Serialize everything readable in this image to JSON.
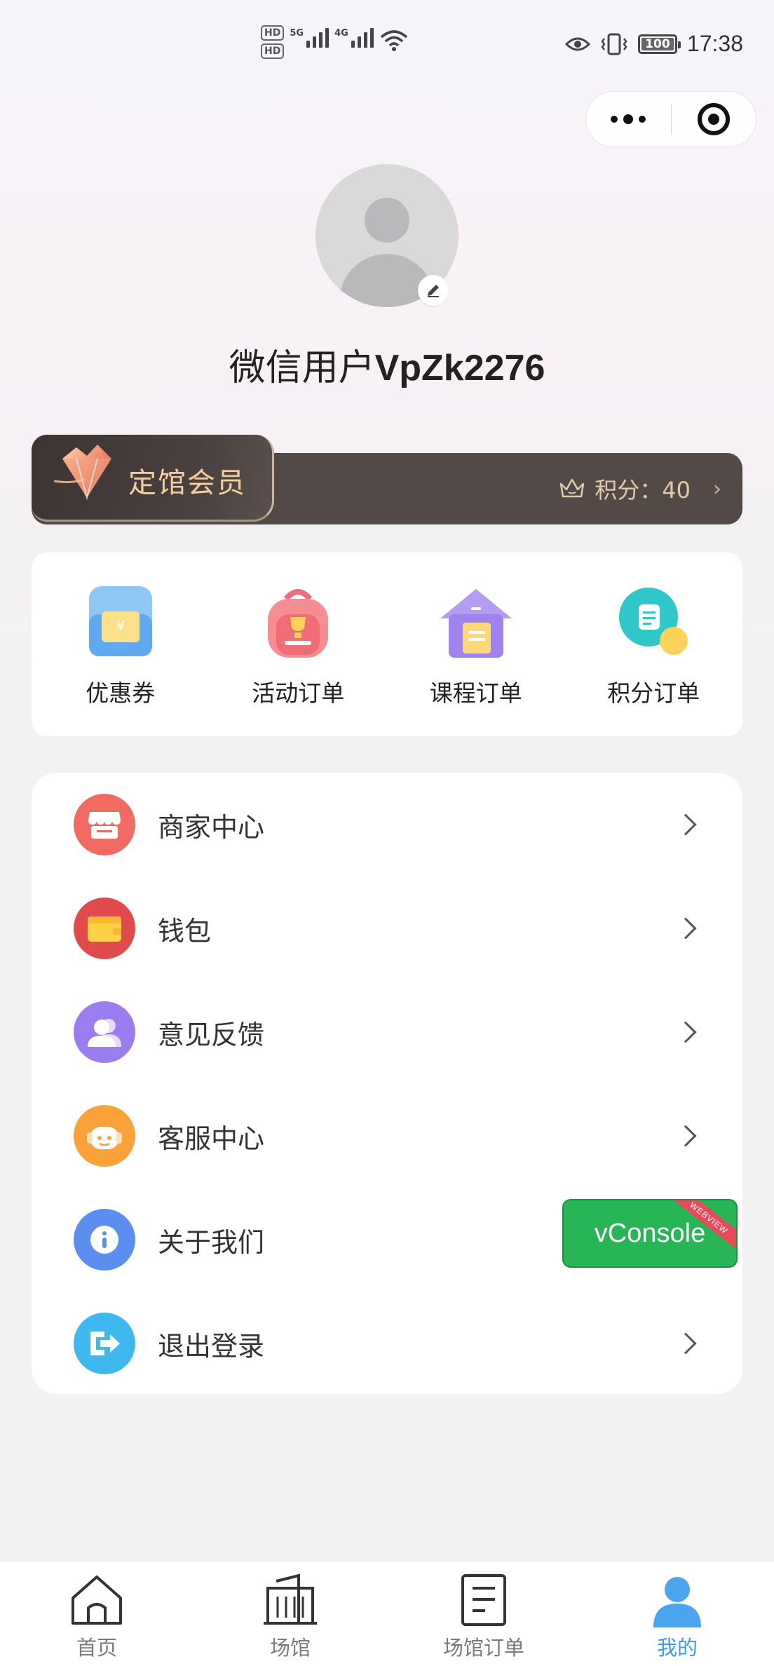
{
  "status_bar": {
    "hd1": "HD",
    "hd2": "HD",
    "net1": "5G",
    "net2": "4G",
    "battery": "100",
    "time": "17:38"
  },
  "capsule": {
    "more_icon": "more-dots-icon",
    "close_icon": "target-icon"
  },
  "profile": {
    "name_prefix": "微信用户",
    "name_suffix": "VpZk2276"
  },
  "member": {
    "title": "定馆会员",
    "points_label": "积分：40",
    "colors": {
      "bar": "#534a48",
      "gold": "#f4cf9d"
    }
  },
  "shortcuts": [
    {
      "label": "优惠券",
      "icon": "coupon-icon"
    },
    {
      "label": "活动订单",
      "icon": "trophy-bag-icon"
    },
    {
      "label": "课程订单",
      "icon": "house-book-icon"
    },
    {
      "label": "积分订单",
      "icon": "points-doc-icon"
    }
  ],
  "menu": [
    {
      "label": "商家中心",
      "icon": "store-icon",
      "color": "#f26b63"
    },
    {
      "label": "钱包",
      "icon": "wallet-icon",
      "color": "#e04a4a"
    },
    {
      "label": "意见反馈",
      "icon": "user-feedback-icon",
      "color": "#9b7df0"
    },
    {
      "label": "客服中心",
      "icon": "headset-icon",
      "color": "#f9a23a"
    },
    {
      "label": "关于我们",
      "icon": "info-icon",
      "color": "#5b8ef0"
    },
    {
      "label": "退出登录",
      "icon": "logout-icon",
      "color": "#3fb8f0"
    }
  ],
  "vconsole": {
    "label": "vConsole",
    "ribbon": "WEBVIEW"
  },
  "tabbar": [
    {
      "label": "首页",
      "icon": "home-icon"
    },
    {
      "label": "场馆",
      "icon": "building-icon"
    },
    {
      "label": "场馆订单",
      "icon": "order-doc-icon"
    },
    {
      "label": "我的",
      "icon": "profile-icon",
      "active": true
    }
  ]
}
